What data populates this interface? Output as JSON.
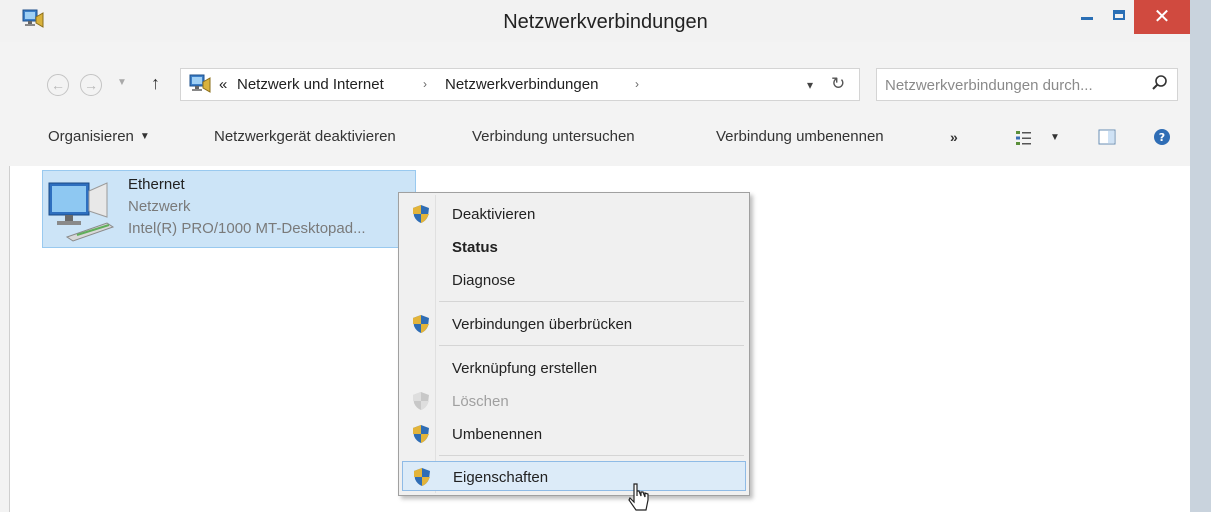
{
  "window": {
    "title": "Netzwerkverbindungen",
    "close_label": "✕"
  },
  "address": {
    "overflow_glyph": "«",
    "crumbs": [
      "Netzwerk und Internet",
      "Netzwerkverbindungen"
    ],
    "separator": "›",
    "search_placeholder": "Netzwerkverbindungen durch..."
  },
  "toolbar": {
    "organize": "Organisieren",
    "disable_device": "Netzwerkgerät deaktivieren",
    "diagnose": "Verbindung untersuchen",
    "rename": "Verbindung umbenennen",
    "more": "»"
  },
  "connection": {
    "name": "Ethernet",
    "type": "Netzwerk",
    "device": "Intel(R) PRO/1000 MT-Desktopad..."
  },
  "context_menu": {
    "items": [
      {
        "label": "Deaktivieren",
        "icon": "shield-icon"
      },
      {
        "label": "Status",
        "bold": true
      },
      {
        "label": "Diagnose"
      },
      {
        "label": "Verbindungen überbrücken",
        "icon": "shield-icon"
      },
      {
        "label": "Verknüpfung erstellen"
      },
      {
        "label": "Löschen",
        "icon": "shield-icon",
        "disabled": true
      },
      {
        "label": "Umbenennen",
        "icon": "shield-icon"
      },
      {
        "label": "Eigenschaften",
        "icon": "shield-icon",
        "highlighted": true
      }
    ]
  },
  "colors": {
    "close_button": "#d04a3f",
    "selection_fill": "#cce4f7",
    "menu_highlight": "#dcebf8"
  }
}
